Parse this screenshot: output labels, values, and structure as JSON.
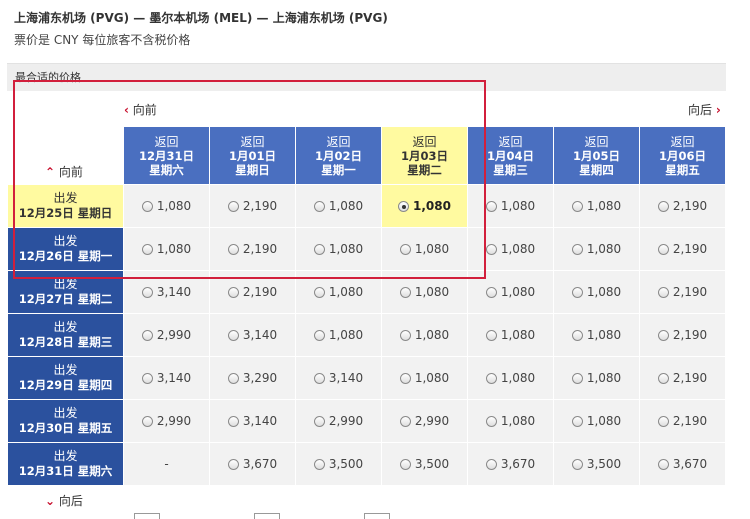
{
  "header": {
    "route": "上海浦东机场 (PVG) — 墨尔本机场 (MEL) — 上海浦东机场 (PVG)",
    "note": "票价是 CNY 每位旅客不含税价格"
  },
  "section": {
    "title": "最合适的价格"
  },
  "nav": {
    "prev_col": "向前",
    "next_col": "向后",
    "prev_row": "向前",
    "next_row": "向后"
  },
  "return_label": "返回",
  "depart_label": "出发",
  "return_dates": [
    {
      "date": "12月31日",
      "weekday": "星期六"
    },
    {
      "date": "1月01日",
      "weekday": "星期日"
    },
    {
      "date": "1月02日",
      "weekday": "星期一"
    },
    {
      "date": "1月03日",
      "weekday": "星期二"
    },
    {
      "date": "1月04日",
      "weekday": "星期三"
    },
    {
      "date": "1月05日",
      "weekday": "星期四"
    },
    {
      "date": "1月06日",
      "weekday": "星期五"
    }
  ],
  "depart_dates": [
    {
      "date": "12月25日",
      "weekday": "星期日"
    },
    {
      "date": "12月26日",
      "weekday": "星期一"
    },
    {
      "date": "12月27日",
      "weekday": "星期二"
    },
    {
      "date": "12月28日",
      "weekday": "星期三"
    },
    {
      "date": "12月29日",
      "weekday": "星期四"
    },
    {
      "date": "12月30日",
      "weekday": "星期五"
    },
    {
      "date": "12月31日",
      "weekday": "星期六"
    }
  ],
  "selected": {
    "row": 0,
    "col": 3
  },
  "prices": [
    [
      "1,080",
      "2,190",
      "1,080",
      "1,080",
      "1,080",
      "1,080",
      "2,190"
    ],
    [
      "1,080",
      "2,190",
      "1,080",
      "1,080",
      "1,080",
      "1,080",
      "2,190"
    ],
    [
      "3,140",
      "2,190",
      "1,080",
      "1,080",
      "1,080",
      "1,080",
      "2,190"
    ],
    [
      "2,990",
      "3,140",
      "1,080",
      "1,080",
      "1,080",
      "1,080",
      "2,190"
    ],
    [
      "3,140",
      "3,290",
      "3,140",
      "1,080",
      "1,080",
      "1,080",
      "2,190"
    ],
    [
      "2,990",
      "3,140",
      "2,990",
      "2,990",
      "1,080",
      "1,080",
      "2,190"
    ],
    [
      "-",
      "3,670",
      "3,500",
      "3,500",
      "3,670",
      "3,500",
      "3,670"
    ]
  ],
  "colors": {
    "header_blue": "#4a6fc0",
    "row_blue": "#2b519e",
    "selected_yellow": "#fffaa0",
    "accent_red": "#c8102e"
  }
}
